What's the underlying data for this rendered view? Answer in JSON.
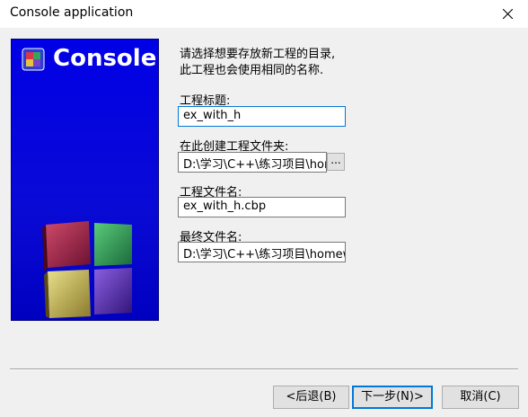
{
  "window": {
    "title": "Console application"
  },
  "banner": {
    "title": "Console",
    "logo_icon": "codeblocks-logo-icon"
  },
  "form": {
    "intro_line1": "请选择想要存放新工程的目录,",
    "intro_line2": "此工程也会使用相同的名称.",
    "project_title_label": "工程标题:",
    "project_title_value": "ex_with_h",
    "folder_label": "在此创建工程文件夹:",
    "folder_value": "D:\\学习\\C++\\练习项目\\homework",
    "browse_label": "...",
    "filename_label": "工程文件名:",
    "filename_value": "ex_with_h.cbp",
    "result_label": "最终文件名:",
    "result_value": "D:\\学习\\C++\\练习项目\\homework\\ex_with_h\\ex_with_h.cbp"
  },
  "buttons": {
    "back": "<后退(B)",
    "next": "下一步(N)>",
    "cancel": "取消(C)"
  }
}
